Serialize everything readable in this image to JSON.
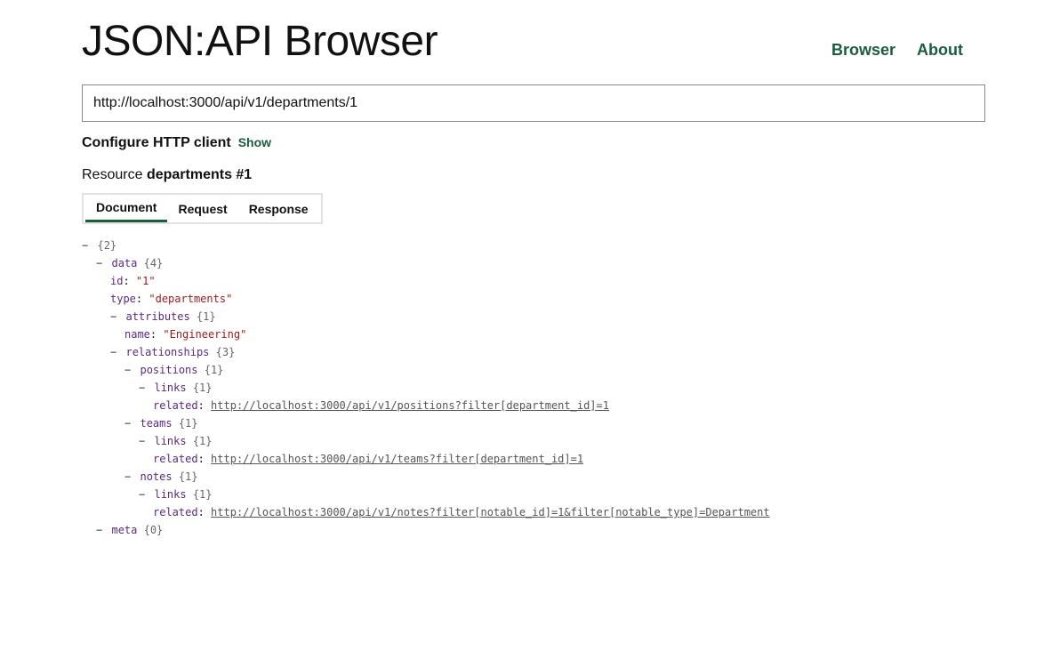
{
  "header": {
    "title": "JSON:API Browser",
    "nav": {
      "browser": "Browser",
      "about": "About"
    }
  },
  "url_bar": {
    "value": "http://localhost:3000/api/v1/departments/1"
  },
  "config": {
    "label": "Configure HTTP client",
    "show": "Show"
  },
  "resource": {
    "prefix": "Resource",
    "name": "departments #1"
  },
  "tabs": {
    "document": "Document",
    "request": "Request",
    "response": "Response",
    "active": "Document"
  },
  "tree": {
    "root_count": "{2}",
    "data_key": "data",
    "data_count": "{4}",
    "id_key": "id",
    "id_value": "\"1\"",
    "type_key": "type",
    "type_value": "\"departments\"",
    "attributes_key": "attributes",
    "attributes_count": "{1}",
    "name_key": "name",
    "name_value": "\"Engineering\"",
    "relationships_key": "relationships",
    "relationships_count": "{3}",
    "positions_key": "positions",
    "positions_count": "{1}",
    "positions_links_key": "links",
    "positions_links_count": "{1}",
    "positions_related_key": "related",
    "positions_related_url": "http://localhost:3000/api/v1/positions?filter[department_id]=1",
    "teams_key": "teams",
    "teams_count": "{1}",
    "teams_links_key": "links",
    "teams_links_count": "{1}",
    "teams_related_key": "related",
    "teams_related_url": "http://localhost:3000/api/v1/teams?filter[department_id]=1",
    "notes_key": "notes",
    "notes_count": "{1}",
    "notes_links_key": "links",
    "notes_links_count": "{1}",
    "notes_related_key": "related",
    "notes_related_url": "http://localhost:3000/api/v1/notes?filter[notable_id]=1&filter[notable_type]=Department",
    "meta_key": "meta",
    "meta_count": "{0}"
  }
}
